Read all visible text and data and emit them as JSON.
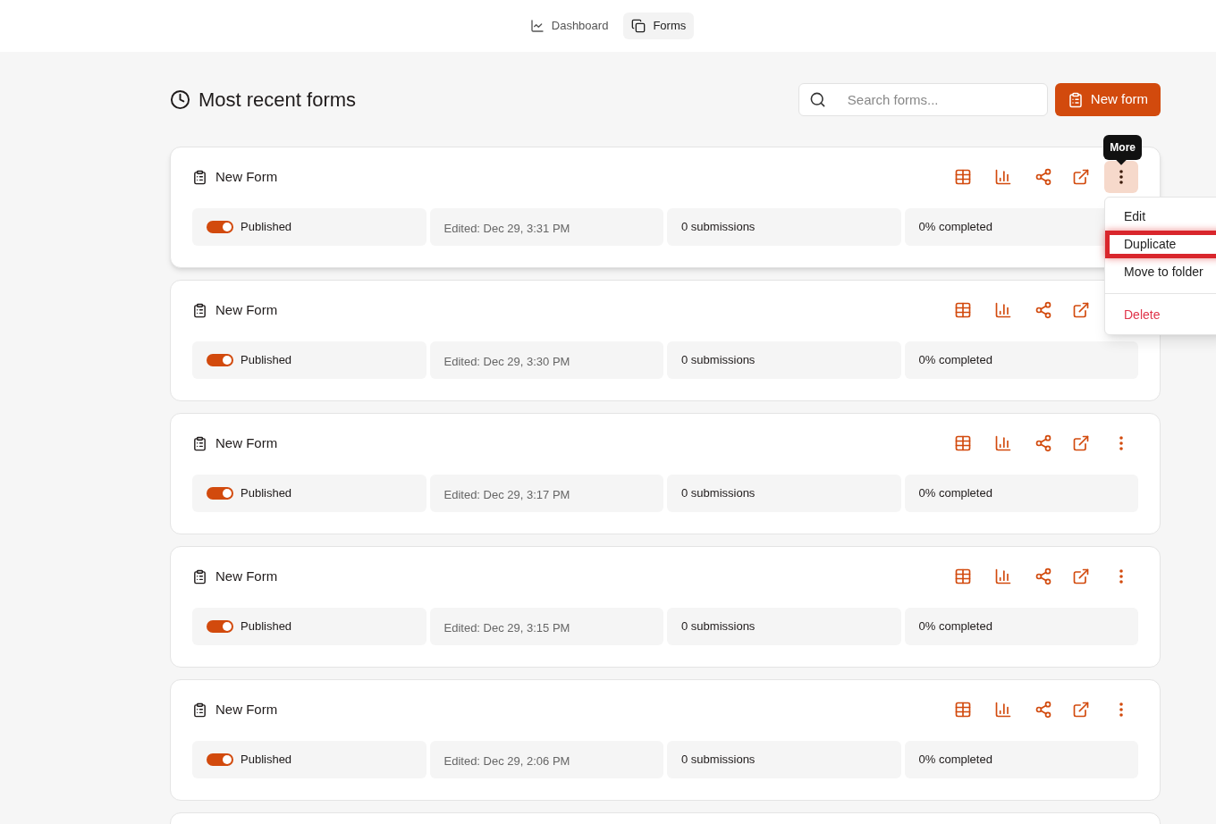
{
  "nav": [
    {
      "label": "Dashboard",
      "selected": false
    },
    {
      "label": "Forms",
      "selected": true
    }
  ],
  "header": {
    "title": "Most recent forms",
    "search": {
      "placeholder": "Search forms..."
    },
    "new_button": "New form"
  },
  "forms": [
    {
      "title": "New Form",
      "published": true,
      "status": "Published",
      "edited": "Edited: Dec 29, 3:31 PM",
      "submissions": "0 submissions",
      "completed": "0% completed",
      "menu_open": true
    },
    {
      "title": "New Form",
      "published": true,
      "status": "Published",
      "edited": "Edited: Dec 29, 3:30 PM",
      "submissions": "0 submissions",
      "completed": "0% completed",
      "menu_open": false
    },
    {
      "title": "New Form",
      "published": true,
      "status": "Published",
      "edited": "Edited: Dec 29, 3:17 PM",
      "submissions": "0 submissions",
      "completed": "0% completed",
      "menu_open": false
    },
    {
      "title": "New Form",
      "published": true,
      "status": "Published",
      "edited": "Edited: Dec 29, 3:15 PM",
      "submissions": "0 submissions",
      "completed": "0% completed",
      "menu_open": false
    },
    {
      "title": "New Form",
      "published": true,
      "status": "Published",
      "edited": "Edited: Dec 29, 2:06 PM",
      "submissions": "0 submissions",
      "completed": "0% completed",
      "menu_open": false
    }
  ],
  "tooltip": "More",
  "menu": [
    {
      "label": "Edit",
      "kind": "item",
      "highlighted": false
    },
    {
      "label": "Duplicate",
      "kind": "item",
      "highlighted": true
    },
    {
      "label": "Move to folder",
      "kind": "item",
      "highlighted": false
    },
    {
      "label": "Delete",
      "kind": "danger",
      "highlighted": false
    }
  ]
}
